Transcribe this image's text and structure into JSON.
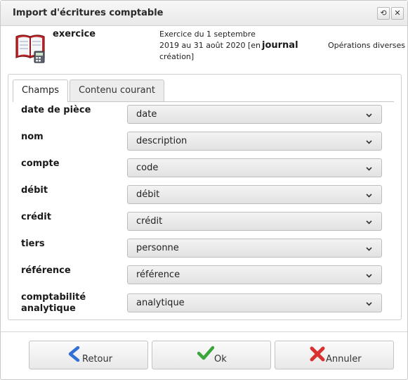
{
  "window": {
    "title": "Import d'écritures comptable"
  },
  "header": {
    "exercice_label": "exercice",
    "exercice_value": "Exercice du 1 septembre 2019 au 31 août 2020 [en création]",
    "journal_label": "journal",
    "journal_value": "Opérations diverses"
  },
  "tabs": [
    {
      "label": "Champs",
      "active": true
    },
    {
      "label": "Contenu courant",
      "active": false
    }
  ],
  "fields": [
    {
      "label": "date de pièce",
      "value": "date"
    },
    {
      "label": "nom",
      "value": "description"
    },
    {
      "label": "compte",
      "value": "code"
    },
    {
      "label": "débit",
      "value": "débit"
    },
    {
      "label": "crédit",
      "value": "crédit"
    },
    {
      "label": "tiers",
      "value": "personne"
    },
    {
      "label": "référence",
      "value": "référence"
    },
    {
      "label": "comptabilité analytique",
      "value": "analytique"
    }
  ],
  "buttons": {
    "retour": "Retour",
    "ok": "Ok",
    "annuler": "Annuler"
  },
  "colors": {
    "ok_check": "#3aa53a",
    "cancel_x": "#d93030",
    "back_arrow": "#2f6fd6",
    "book_cover": "#c0282d"
  }
}
